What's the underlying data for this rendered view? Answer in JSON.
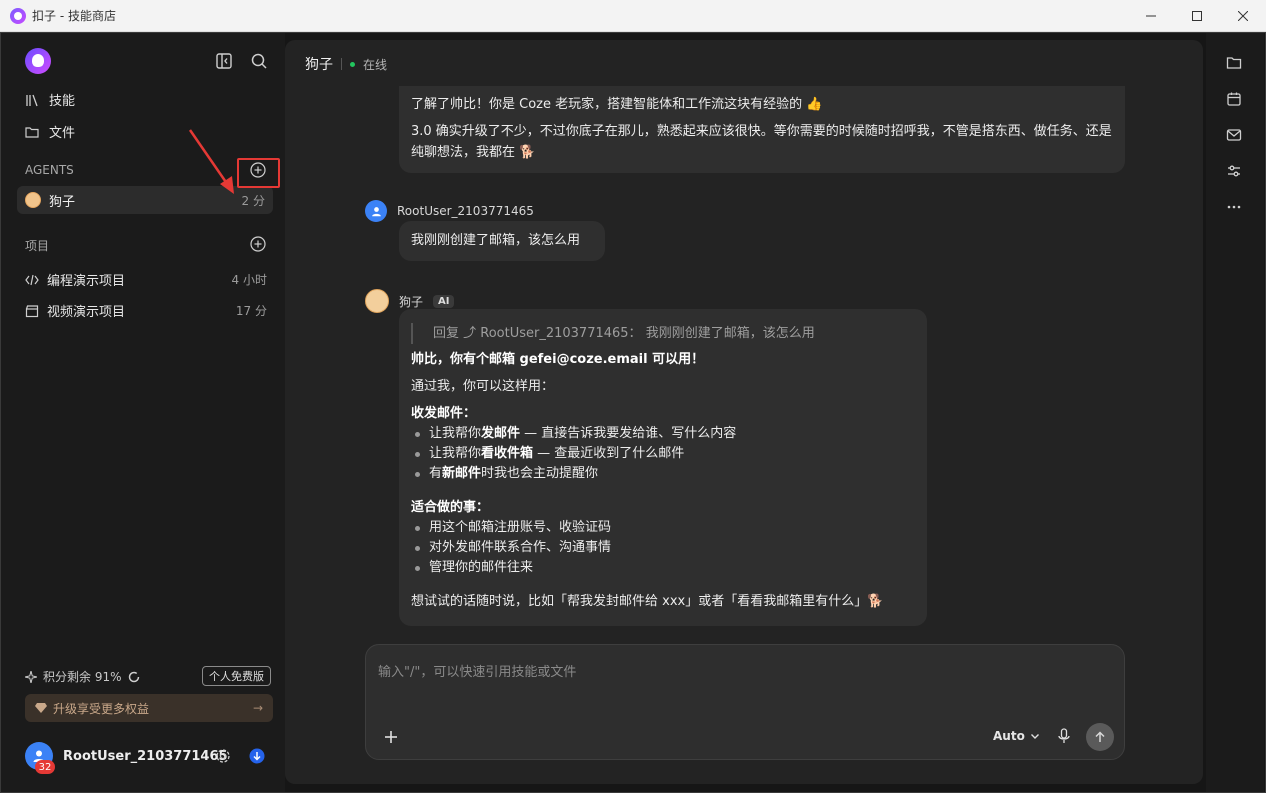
{
  "window": {
    "title": "扣子 - 技能商店",
    "controls": {
      "minimize": "minimize",
      "maximize": "maximize",
      "close": "close"
    }
  },
  "sidebar": {
    "nav": [
      {
        "label": "技能",
        "icon": "library-icon"
      },
      {
        "label": "文件",
        "icon": "folder-icon"
      }
    ],
    "agents_label": "AGENTS",
    "agents": [
      {
        "name": "狗子",
        "time": "2 分"
      }
    ],
    "projects_label": "项目",
    "projects": [
      {
        "name": "编程演示项目",
        "time": "4 小时",
        "icon": "code-icon"
      },
      {
        "name": "视频演示项目",
        "time": "17 分",
        "icon": "clapper-icon"
      }
    ],
    "credits": {
      "label": "积分剩余 91%",
      "plan": "个人免费版"
    },
    "upgrade_label": "升级享受更多权益",
    "user": {
      "name": "RootUser_2103771465",
      "badge": "32"
    }
  },
  "chat": {
    "agent_name": "狗子",
    "status": "在线",
    "messages": [
      {
        "paragraphs": [
          "了解了帅比！你是 Coze 老玩家，搭建智能体和工作流这块有经验的 👍",
          "3.0 确实升级了不少，不过你底子在那儿，熟悉起来应该很快。等你需要的时候随时招呼我，不管是搭东西、做任务、还是纯聊想法，我都在 🐕"
        ]
      },
      {
        "sender": "RootUser_2103771465",
        "text": "我刚刚创建了邮箱，该怎么用"
      },
      {
        "sender": "狗子",
        "tag": "AI",
        "quote": "回复 ⤴ RootUser_2103771465： 我刚刚创建了邮箱，该怎么用",
        "intro_pre": "帅比，你有个邮箱 ",
        "email": "gefei@coze.email",
        "intro_post": " 可以用！",
        "line2": "通过我，你可以这样用：",
        "section1": "收发邮件：",
        "items1": [
          {
            "pre": "让我帮你",
            "bold": "发邮件",
            "post": " — 直接告诉我要发给谁、写什么内容"
          },
          {
            "pre": "让我帮你",
            "bold": "看收件箱",
            "post": " — 查最近收到了什么邮件"
          },
          {
            "pre": "有",
            "bold": "新邮件",
            "post": "时我也会主动提醒你"
          }
        ],
        "section2": "适合做的事：",
        "items2": [
          "用这个邮箱注册账号、收验证码",
          "对外发邮件联系合作、沟通事情",
          "管理你的邮件往来"
        ],
        "closing": "想试试的话随时说，比如「帮我发封邮件给 xxx」或者「看看我邮箱里有什么」🐕"
      }
    ],
    "composer": {
      "placeholder": "输入\"/\"，可以快速引用技能或文件",
      "model": "Auto"
    }
  },
  "right_rail": [
    "folder-icon",
    "calendar-icon",
    "mail-icon",
    "sliders-icon",
    "more-icon"
  ]
}
